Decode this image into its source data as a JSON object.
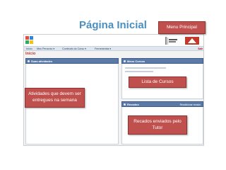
{
  "slide": {
    "title": "Página Inicial",
    "menu_principal_callout": "Menu Principal",
    "cursos_callout": "Lista de Cursos",
    "atividades_callout": "Atividades que devem ser entregues na semana",
    "recados_callout": "Recados enviados pelo Tutor"
  },
  "menu": {
    "items": [
      "Início",
      "Meu Percurso ▾",
      "Conteúdo do Curso ▾",
      "Ferramentas ▾"
    ],
    "logout_label": "Sair"
  },
  "breadcrumb": "Início",
  "panels": {
    "atividades_title": "Suas atividades",
    "cursos_title": "Meus Cursos",
    "recados_title": "Recados",
    "recados_right": "Readicionar recado"
  },
  "colors": {
    "accent": "#4a8fbf",
    "callout": "#c0504d",
    "panel_header": "#5b7aa8",
    "breadcrumb": "#c0392b"
  }
}
